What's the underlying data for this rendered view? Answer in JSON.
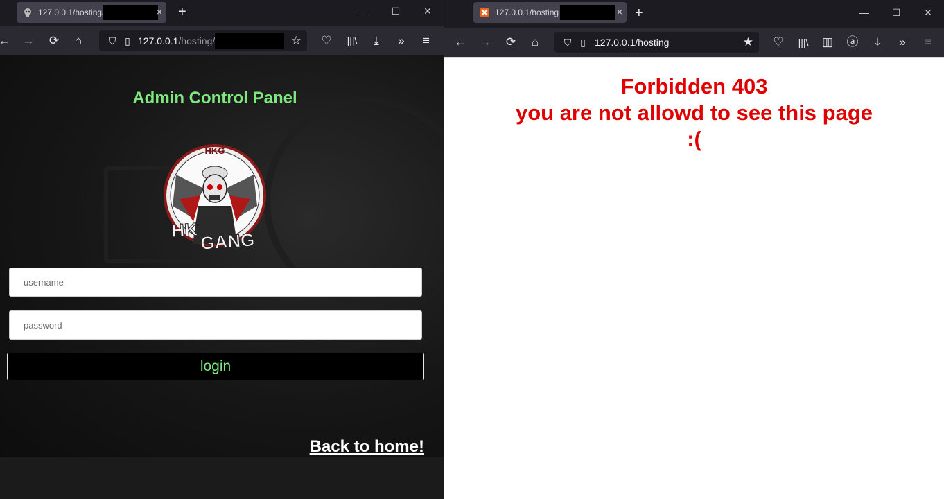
{
  "left_window": {
    "tab": {
      "title": "127.0.0.1/hosting/",
      "close_label": "×"
    },
    "new_tab_label": "+",
    "controls": {
      "minimize": "—",
      "maximize": "☐",
      "close": "✕"
    },
    "url": {
      "host": "127.0.0.1",
      "path": "/hosting/"
    },
    "page": {
      "title": "Admin Control Panel",
      "logo": {
        "top_text": "HKG",
        "line1": "HK",
        "line2": "GANG"
      },
      "username_placeholder": "username",
      "password_placeholder": "password",
      "login_label": "login",
      "back_link": "Back to home!"
    }
  },
  "right_window": {
    "tab": {
      "title": "127.0.0.1/hosting",
      "close_label": "×"
    },
    "new_tab_label": "+",
    "controls": {
      "minimize": "—",
      "maximize": "☐",
      "close": "✕"
    },
    "url": {
      "host": "127.0.0.1",
      "path": "/hosting"
    },
    "page": {
      "line1": "Forbidden 403",
      "line2": "you are not allowd to see this page",
      "line3": ":("
    }
  },
  "colors": {
    "panel_green": "#7ee87e",
    "error_red": "#e00000",
    "browser_dark": "#1c1b22",
    "toolbar": "#2b2a33"
  }
}
